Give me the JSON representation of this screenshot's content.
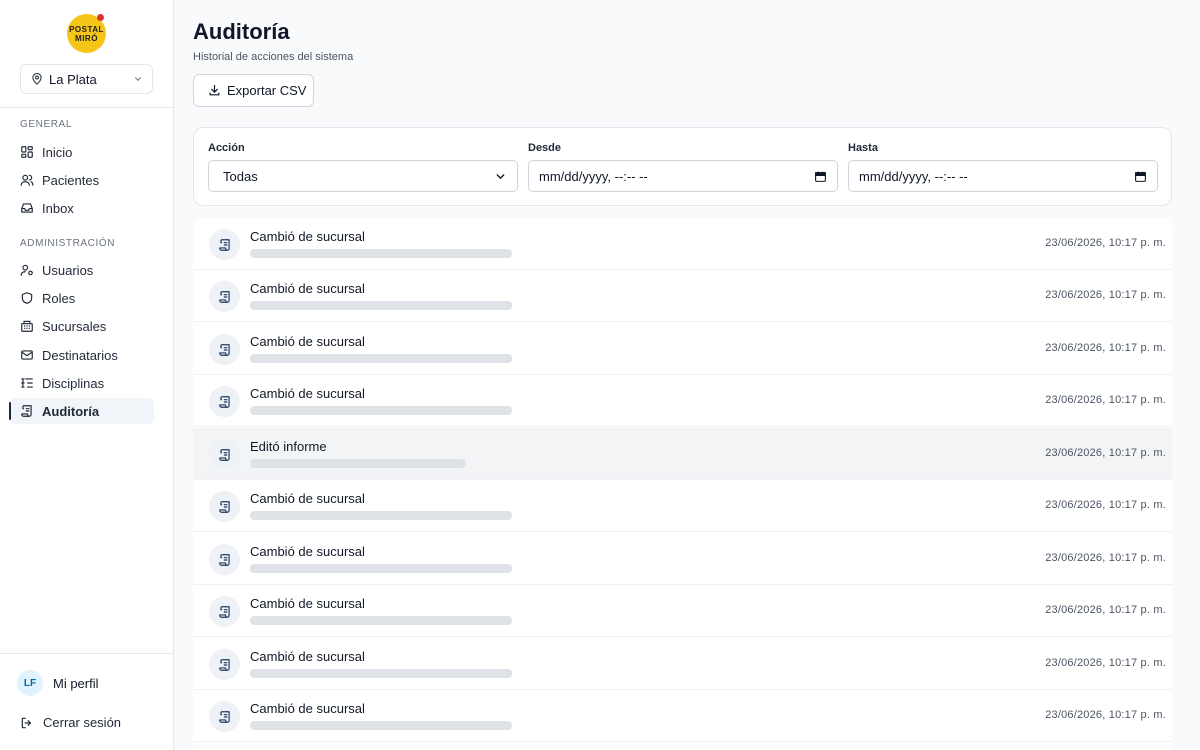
{
  "brand": {
    "logo_line1": "POSTAL",
    "logo_line2": "MIRÓ",
    "color": "#f5c518"
  },
  "location": {
    "selected": "La Plata",
    "icon": "map-pin-icon"
  },
  "sidebar": {
    "general_label": "GENERAL",
    "general_items": [
      {
        "label": "Inicio",
        "icon": "dashboard-icon"
      },
      {
        "label": "Pacientes",
        "icon": "users-icon"
      },
      {
        "label": "Inbox",
        "icon": "inbox-icon"
      }
    ],
    "admin_label": "ADMINISTRACIÓN",
    "admin_items": [
      {
        "label": "Usuarios",
        "icon": "user-cog-icon"
      },
      {
        "label": "Roles",
        "icon": "shield-icon"
      },
      {
        "label": "Sucursales",
        "icon": "building-icon"
      },
      {
        "label": "Destinatarios",
        "icon": "mail-icon"
      },
      {
        "label": "Disciplinas",
        "icon": "list-tree-icon"
      },
      {
        "label": "Auditoría",
        "icon": "scroll-icon",
        "active": true
      }
    ],
    "profile": {
      "initials": "LF",
      "label": "Mi perfil"
    },
    "logout_label": "Cerrar sesión"
  },
  "page": {
    "title": "Auditoría",
    "subtitle": "Historial de acciones del sistema",
    "export_label": "Exportar CSV"
  },
  "filters": {
    "action_label": "Acción",
    "action_value": "Todas",
    "from_label": "Desde",
    "from_placeholder": "mm/dd/yyyy, --:-- --",
    "to_label": "Hasta",
    "to_placeholder": "mm/dd/yyyy, --:-- --"
  },
  "audit_rows": [
    {
      "title": "Cambió de sucursal",
      "time": "23/06/2026, 10:17 p. m."
    },
    {
      "title": "Cambió de sucursal",
      "time": "23/06/2026, 10:17 p. m."
    },
    {
      "title": "Cambió de sucursal",
      "time": "23/06/2026, 10:17 p. m."
    },
    {
      "title": "Cambió de sucursal",
      "time": "23/06/2026, 10:17 p. m."
    },
    {
      "title": "Editó informe",
      "time": "23/06/2026, 10:17 p. m.",
      "highlighted": true
    },
    {
      "title": "Cambió de sucursal",
      "time": "23/06/2026, 10:17 p. m."
    },
    {
      "title": "Cambió de sucursal",
      "time": "23/06/2026, 10:17 p. m."
    },
    {
      "title": "Cambió de sucursal",
      "time": "23/06/2026, 10:17 p. m."
    },
    {
      "title": "Cambió de sucursal",
      "time": "23/06/2026, 10:17 p. m."
    },
    {
      "title": "Cambió de sucursal",
      "time": "23/06/2026, 10:17 p. m."
    }
  ]
}
